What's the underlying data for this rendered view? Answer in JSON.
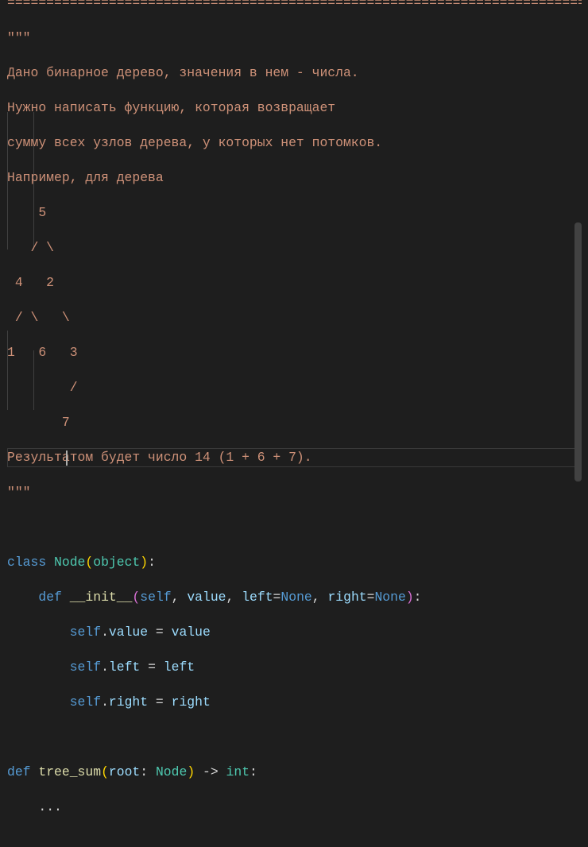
{
  "editor": {
    "language": "python",
    "lines": [
      {
        "text": "=========================================================================="
      },
      {
        "text": "\"\"\""
      },
      {
        "text": "Дано бинарное дерево, значения в нем - числа."
      },
      {
        "text": "Нужно написать функцию, которая возвращает"
      },
      {
        "text": "сумму всех узлов дерева, у которых нет потомков."
      },
      {
        "text": "Например, для дерева"
      },
      {
        "text": "    5"
      },
      {
        "text": "   / \\"
      },
      {
        "text": " 4   2"
      },
      {
        "text": " / \\   \\"
      },
      {
        "text": "1   6   3"
      },
      {
        "text": "        /"
      },
      {
        "text": "       7"
      },
      {
        "text": "Результатом будет число 14 (1 + 6 + 7)."
      },
      {
        "text": "\"\"\""
      },
      {
        "text": ""
      },
      {
        "text": "class Node(object):"
      },
      {
        "text": "    def __init__(self, value, left=None, right=None):"
      },
      {
        "text": "        self.value = value"
      },
      {
        "text": "        self.left = left"
      },
      {
        "text": "        self.right = right"
      },
      {
        "text": ""
      },
      {
        "text": "def tree_sum(root: Node) -> int:"
      },
      {
        "text": "    ..."
      }
    ]
  },
  "tokens": {
    "kw_class": "class",
    "kw_def": "def",
    "cls_node": "Node",
    "cls_object": "object",
    "fn_init": "__init__",
    "self": "self",
    "p_value": "value",
    "p_left": "left",
    "p_right": "right",
    "const_none": "None",
    "fn_tree_sum": "tree_sum",
    "p_root": "root",
    "bi_int": "int",
    "ellipsis": "..."
  },
  "theme": {
    "background": "#1e1e1e",
    "string": "#ce9178",
    "keyword": "#569cd6",
    "class": "#4ec9b0",
    "function": "#dcdcaa",
    "variable": "#9cdcfe"
  }
}
